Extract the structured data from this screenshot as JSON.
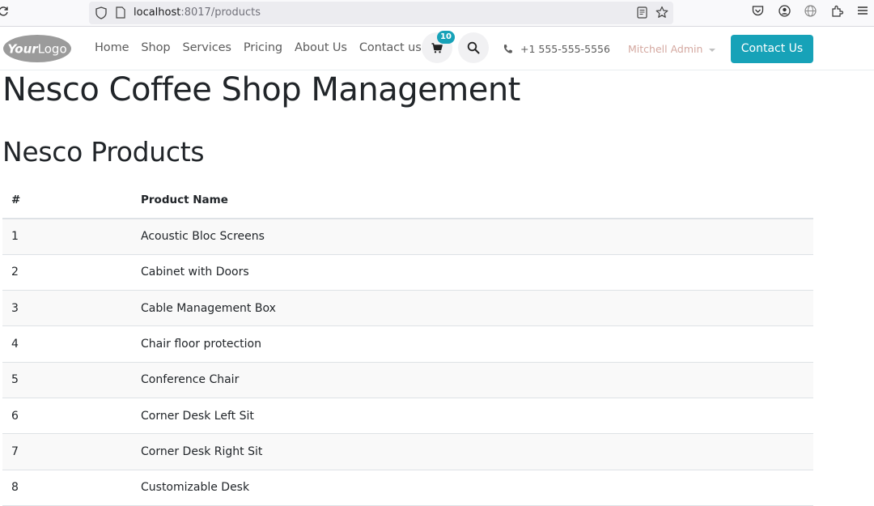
{
  "browser": {
    "url_host": "localhost",
    "url_path": ":8017/products"
  },
  "header": {
    "logo_text": "YourLogo",
    "nav": [
      "Home",
      "Shop",
      "Services",
      "Pricing",
      "About Us",
      "Contact us"
    ],
    "cart_count": "10",
    "phone": "+1 555-555-5556",
    "user_name": "Mitchell Admin",
    "contact_button": "Contact Us"
  },
  "page": {
    "title": "Nesco Coffee Shop Management",
    "section_title": "Nesco Products"
  },
  "table": {
    "columns": [
      "#",
      "Product Name"
    ],
    "rows": [
      [
        "1",
        "Acoustic Bloc Screens"
      ],
      [
        "2",
        "Cabinet with Doors"
      ],
      [
        "3",
        "Cable Management Box"
      ],
      [
        "4",
        "Chair floor protection"
      ],
      [
        "5",
        "Conference Chair"
      ],
      [
        "6",
        "Corner Desk Left Sit"
      ],
      [
        "7",
        "Corner Desk Right Sit"
      ],
      [
        "8",
        "Customizable Desk"
      ]
    ]
  },
  "icons": {
    "reload": "reload-icon",
    "shield": "shield-icon",
    "page": "page-icon",
    "reader": "reader-view-icon",
    "star": "bookmark-star-icon",
    "pocket": "pocket-icon",
    "account": "account-icon",
    "globe": "globe-icon",
    "extensions": "extensions-icon",
    "menu": "hamburger-menu-icon",
    "cart": "cart-icon",
    "search": "search-icon",
    "phone": "phone-icon"
  },
  "colors": {
    "accent": "#17a2b8",
    "user_name": "#d4a8a0"
  }
}
